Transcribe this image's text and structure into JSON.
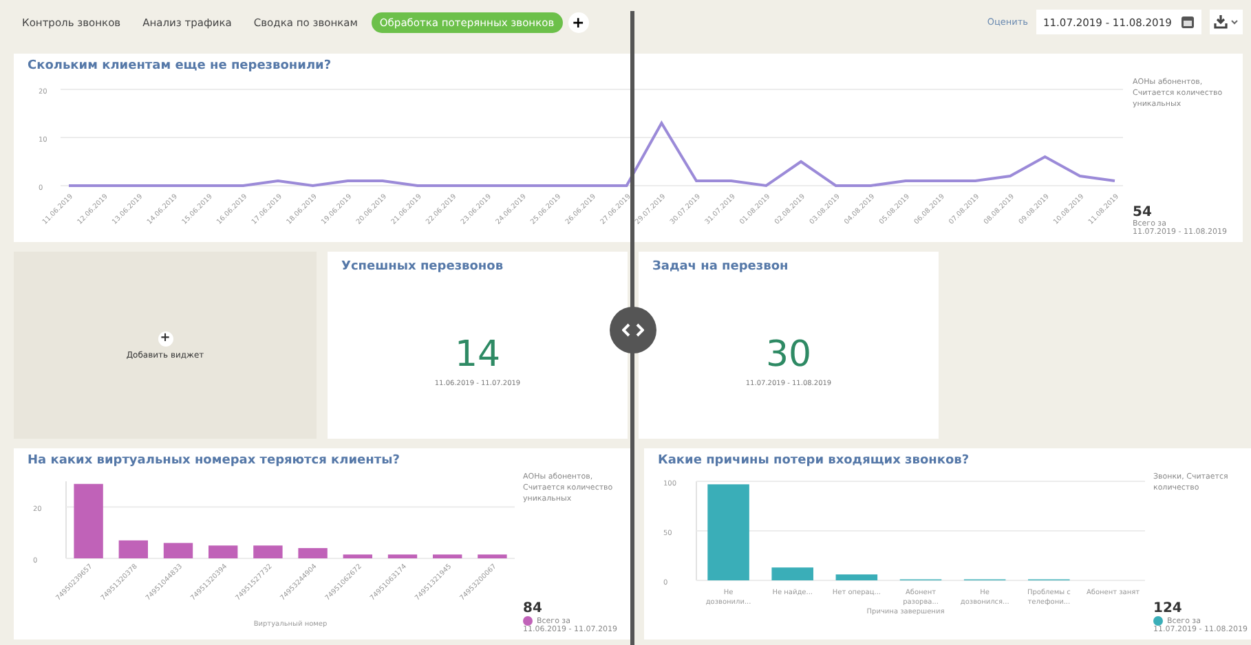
{
  "tabs": [
    {
      "label": "Контроль звонков",
      "selected": false
    },
    {
      "label": "Анализ трафика",
      "selected": false
    },
    {
      "label": "Сводка по звонкам",
      "selected": false
    },
    {
      "label": "Обработка потерянных звонков",
      "selected": true
    }
  ],
  "add_tab": "+",
  "toolbar": {
    "label": "Оценить",
    "date_range": "11.07.2019 - 11.08.2019"
  },
  "line_widget": {
    "title": "Скольким клиентам еще не перезвонили?",
    "metric": "АОНы абонентов, Считается количество уникальных",
    "total": "54",
    "total_label": "Всего за",
    "period": "11.07.2019 - 11.08.2019",
    "chart_data": {
      "type": "line",
      "categories": [
        "11.06.2019",
        "12.06.2019",
        "13.06.2019",
        "14.06.2019",
        "15.06.2019",
        "16.06.2019",
        "17.06.2019",
        "18.06.2019",
        "19.06.2019",
        "20.06.2019",
        "21.06.2019",
        "22.06.2019",
        "23.06.2019",
        "24.06.2019",
        "25.06.2019",
        "26.06.2019",
        "27.06.2019",
        "29.07.2019",
        "30.07.2019",
        "31.07.2019",
        "01.08.2019",
        "02.08.2019",
        "03.08.2019",
        "04.08.2019",
        "05.08.2019",
        "06.08.2019",
        "07.08.2019",
        "08.08.2019",
        "09.08.2019",
        "10.08.2019",
        "11.08.2019"
      ],
      "series": [
        {
          "color": "#9b8ad8",
          "values": [
            0,
            0,
            0,
            0,
            0,
            0,
            1,
            0,
            1,
            1,
            0,
            0,
            0,
            0,
            0,
            0,
            0,
            13,
            1,
            1,
            0,
            5,
            0,
            0,
            1,
            1,
            1,
            2,
            6,
            2,
            1
          ]
        }
      ],
      "ylim": [
        0,
        20
      ],
      "yticks": [
        0,
        10,
        20
      ]
    }
  },
  "add_widget": {
    "icon": "+",
    "label": "Добавить виджет"
  },
  "kpis": [
    {
      "title": "Успешных перезвонов",
      "value": "14",
      "period": "11.06.2019 - 11.07.2019"
    },
    {
      "title": "Задач на перезвон",
      "value": "30",
      "period": "11.07.2019 - 11.08.2019"
    }
  ],
  "bar_widgets": [
    {
      "title": "На каких виртуальных номерах теряются клиенты?",
      "metric": "АОНы абонентов, Считается количество уникальных",
      "total": "84",
      "period": "11.06.2019 - 11.07.2019",
      "chart_data": {
        "type": "bar",
        "xlabel": "Виртуальный номер",
        "categories": [
          "74950239657",
          "74951320378",
          "74951044833",
          "74951320394",
          "74951527732",
          "74953244904",
          "74951062672",
          "74951063174",
          "74951321945",
          "74953200067"
        ],
        "series": [
          {
            "name": "Всего за",
            "color": "#c062b8",
            "values": [
              29,
              7,
              6,
              5,
              5,
              4,
              1.5,
              1.5,
              1.5,
              1.5
            ]
          }
        ],
        "ylim": [
          0,
          30
        ],
        "yticks": [
          0,
          20
        ]
      }
    },
    {
      "title": "Какие причины потери входящих звонков?",
      "metric": "Звонки, Считается количество",
      "total": "124",
      "period": "11.07.2019 - 11.08.2019",
      "chart_data": {
        "type": "bar",
        "xlabel": "Причина завершения",
        "categories": [
          "Не дозвонили...",
          "Не найде...",
          "Нет операц...",
          "Абонент разорва...",
          "Не дозвонился...",
          "Проблемы с телефони...",
          "Абонент занят"
        ],
        "series": [
          {
            "name": "Всего за",
            "color": "#3aaeb8",
            "values": [
              97,
              13,
              6,
              1,
              1,
              1,
              0
            ]
          }
        ],
        "ylim": [
          0,
          100
        ],
        "yticks": [
          0,
          50,
          100
        ]
      }
    }
  ]
}
